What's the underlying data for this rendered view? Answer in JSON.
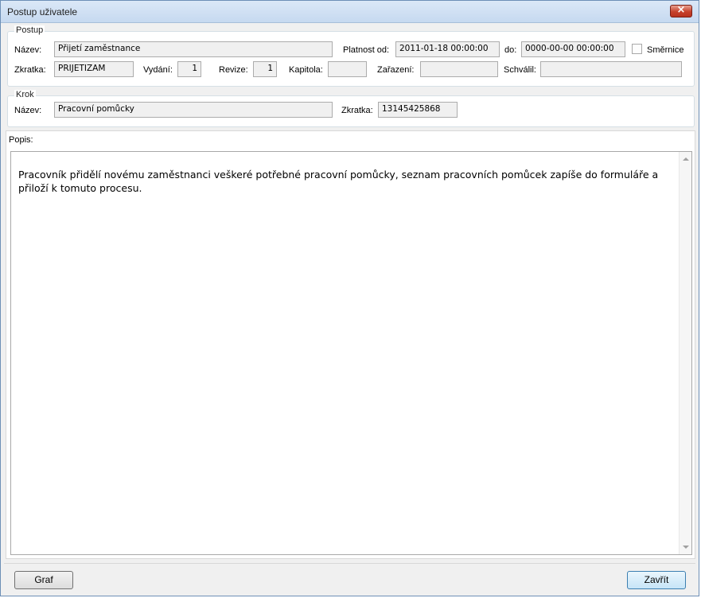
{
  "window": {
    "title": "Postup uživatele",
    "close_icon": "×"
  },
  "postup": {
    "legend": "Postup",
    "nazev_label": "Název:",
    "nazev_value": "Přijetí zaměstnance",
    "platnost_label": "Platnost od:",
    "platnost_od": "2011-01-18 00:00:00",
    "do_label": "do:",
    "platnost_do": "0000-00-00 00:00:00",
    "smernice_label": "Směrnice",
    "smernice_checked": false,
    "zkratka_label": "Zkratka:",
    "zkratka_value": "PRIJETIZAM",
    "vydani_label": "Vydání:",
    "vydani_value": "1",
    "revize_label": "Revize:",
    "revize_value": "1",
    "kapitola_label": "Kapitola:",
    "kapitola_value": "",
    "zarazeni_label": "Zařazení:",
    "zarazeni_value": "",
    "schvalil_label": "Schválil:",
    "schvalil_value": ""
  },
  "krok": {
    "legend": "Krok",
    "nazev_label": "Název:",
    "nazev_value": "Pracovní pomůcky",
    "zkratka_label": "Zkratka:",
    "zkratka_value": "13145425868"
  },
  "popis": {
    "label": "Popis:",
    "text": "Pracovník přidělí novému zaměstnanci veškeré potřebné pracovní pomůcky, seznam pracovních pomůcek zapíše do formuláře a přiloží k tomuto procesu."
  },
  "buttons": {
    "graf": "Graf",
    "zavrit": "Zavřít"
  }
}
